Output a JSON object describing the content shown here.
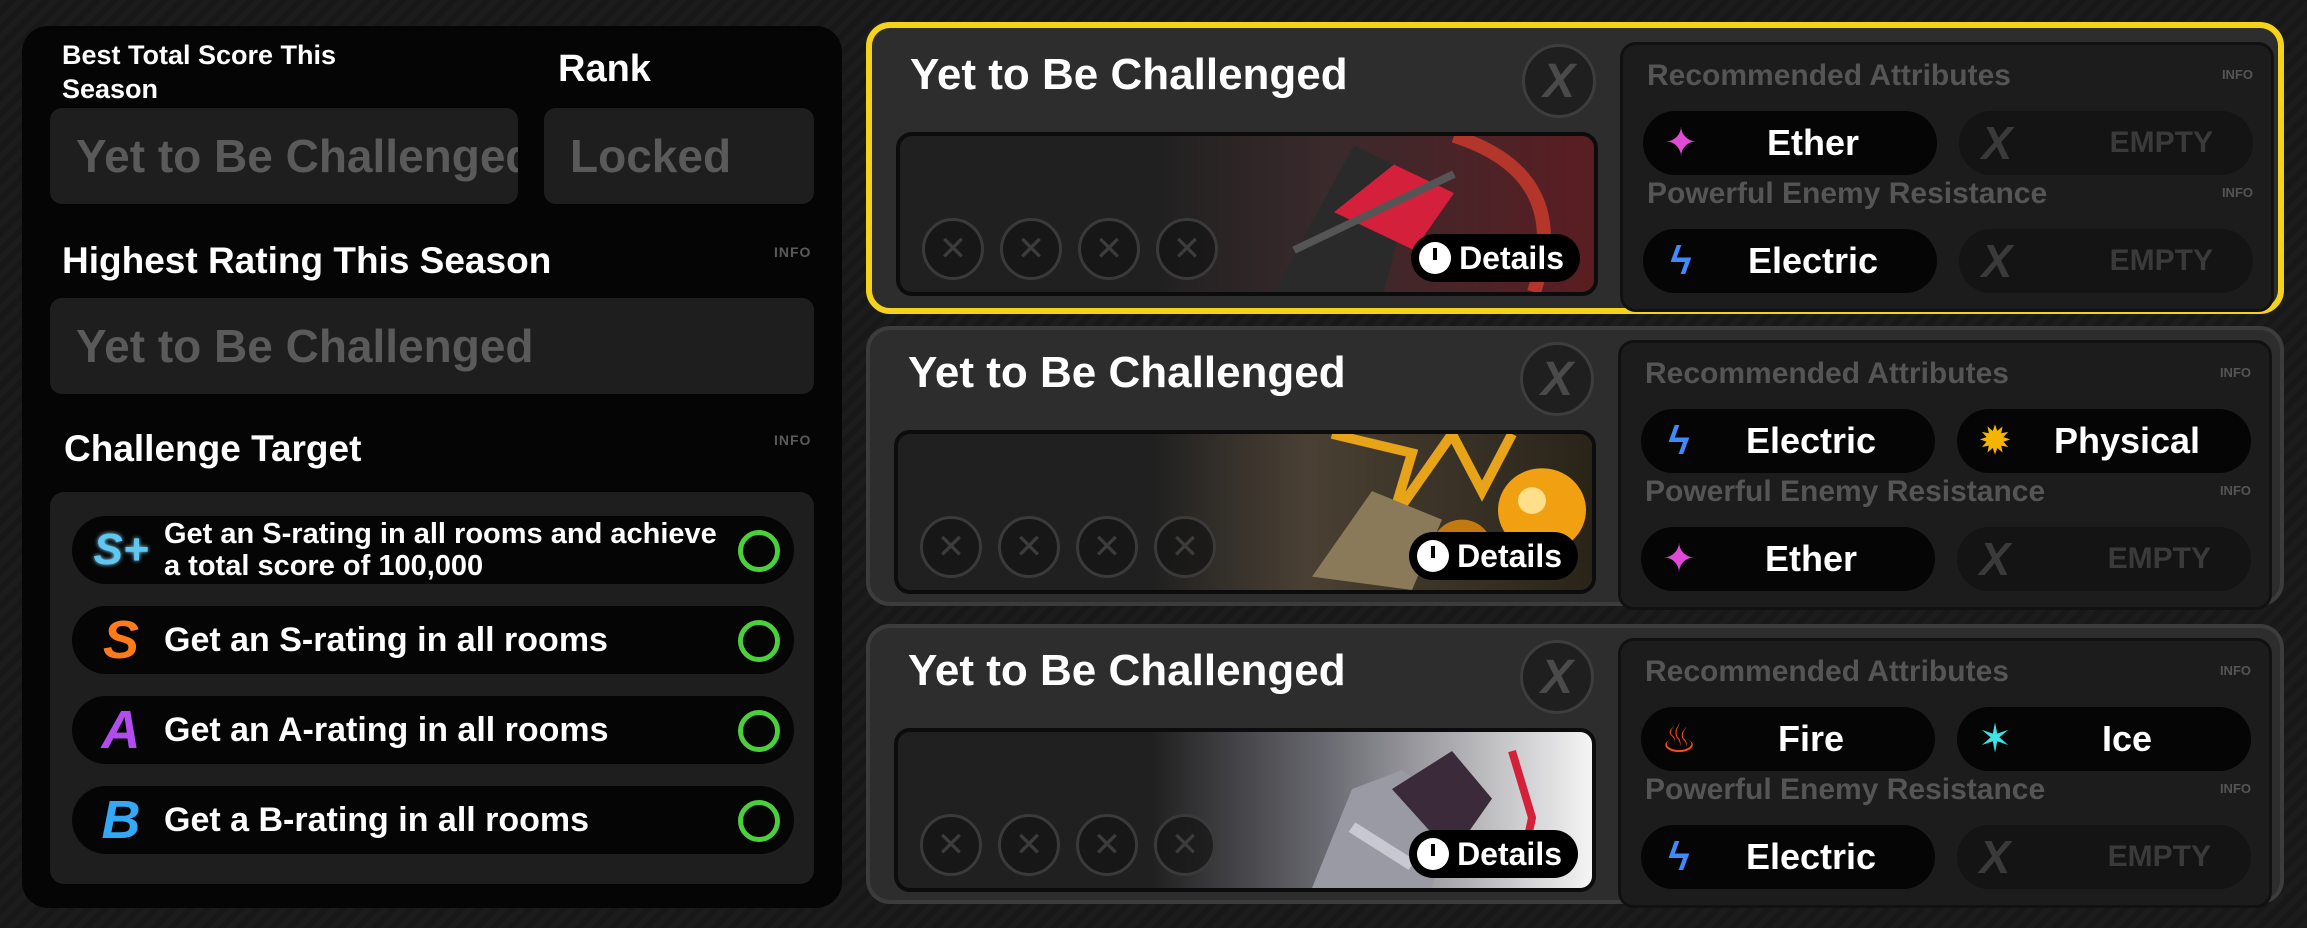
{
  "summary": {
    "best_total_label": "Best Total Score This Season",
    "best_total_value": "Yet to Be Challenged",
    "rank_label": "Rank",
    "rank_value": "Locked",
    "highest_rating_label": "Highest Rating This Season",
    "highest_rating_value": "Yet to Be Challenged",
    "info": "INFO",
    "challenge_target_label": "Challenge Target"
  },
  "targets": [
    {
      "rank": "S+",
      "text": "Get an S-rating in all rooms and achieve a total score of 100,000"
    },
    {
      "rank": "S",
      "text": "Get an S-rating in all rooms"
    },
    {
      "rank": "A",
      "text": "Get an A-rating in all rooms"
    },
    {
      "rank": "B",
      "text": "Get a B-rating in all rooms"
    }
  ],
  "labels": {
    "recommended": "Recommended Attributes",
    "resistance": "Powerful Enemy Resistance",
    "info": "INFO",
    "details": "Details",
    "close": "X",
    "empty": "EMPTY"
  },
  "cards": [
    {
      "title": "Yet to Be Challenged",
      "selected": true,
      "recommended": [
        "Ether",
        "EMPTY"
      ],
      "resistance": [
        "Electric",
        "EMPTY"
      ]
    },
    {
      "title": "Yet to Be Challenged",
      "selected": false,
      "recommended": [
        "Electric",
        "Physical"
      ],
      "resistance": [
        "Ether",
        "EMPTY"
      ]
    },
    {
      "title": "Yet to Be Challenged",
      "selected": false,
      "recommended": [
        "Fire",
        "Ice"
      ],
      "resistance": [
        "Electric",
        "EMPTY"
      ]
    }
  ],
  "colors": {
    "selected_border": "#f5d31a",
    "target_ring": "#4ccf3c",
    "ether": "#e04ad6",
    "electric": "#3d8bff",
    "physical": "#f5b400",
    "fire": "#ff4a1a",
    "ice": "#3fe0e6"
  }
}
